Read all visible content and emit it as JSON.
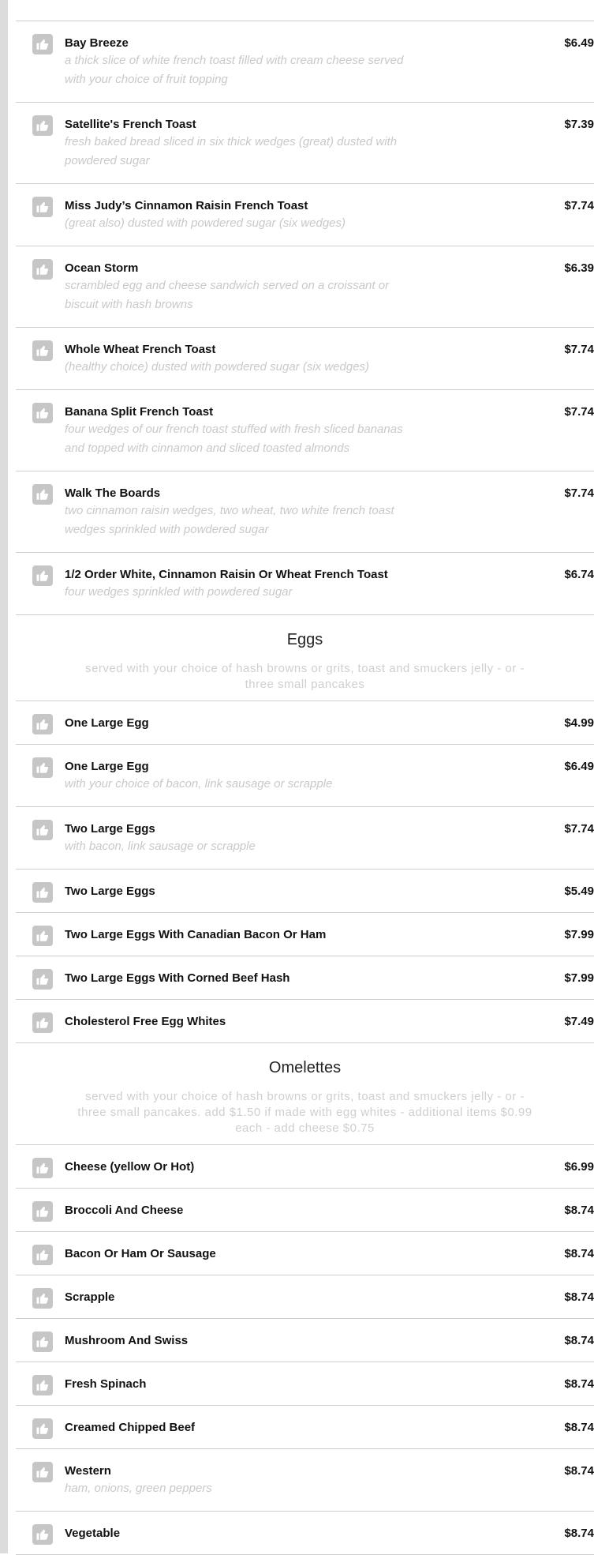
{
  "groups": [
    {
      "items": [
        {
          "name": "Bay Breeze",
          "desc": "a thick slice of white french toast filled with cream cheese served with your choice of fruit topping",
          "price": "$6.49"
        },
        {
          "name": "Satellite's French Toast",
          "desc": "fresh baked bread sliced in six thick wedges (great) dusted with powdered sugar",
          "price": "$7.39"
        },
        {
          "name": "Miss Judy’s Cinnamon Raisin French Toast",
          "desc": "(great also) dusted with powdered sugar (six wedges)",
          "price": "$7.74"
        },
        {
          "name": "Ocean Storm",
          "desc": "scrambled egg and cheese sandwich served on a croissant or biscuit with hash browns",
          "price": "$6.39"
        },
        {
          "name": "Whole Wheat French Toast",
          "desc": "(healthy choice) dusted with powdered sugar (six wedges)",
          "price": "$7.74"
        },
        {
          "name": "Banana Split French Toast",
          "desc": "four wedges of our french toast stuffed with fresh sliced bananas and topped with cinnamon and sliced toasted almonds",
          "price": "$7.74"
        },
        {
          "name": "Walk The Boards",
          "desc": "two cinnamon raisin wedges, two wheat, two white french toast wedges sprinkled with powdered sugar",
          "price": "$7.74"
        },
        {
          "name": "1/2 Order White, Cinnamon Raisin Or Wheat French Toast",
          "desc": "four wedges sprinkled with powdered sugar",
          "price": "$6.74"
        }
      ]
    },
    {
      "title": "Eggs",
      "note": "served with your choice of hash browns or grits, toast and smuckers jelly - or - three small pancakes",
      "items": [
        {
          "name": "One Large Egg",
          "desc": "",
          "price": "$4.99"
        },
        {
          "name": "One Large Egg",
          "desc": "with your choice of bacon, link sausage or scrapple",
          "price": "$6.49"
        },
        {
          "name": "Two Large Eggs",
          "desc": "with bacon, link sausage or scrapple",
          "price": "$7.74"
        },
        {
          "name": "Two Large Eggs",
          "desc": "",
          "price": "$5.49"
        },
        {
          "name": "Two Large Eggs With Canadian Bacon Or Ham",
          "desc": "",
          "price": "$7.99"
        },
        {
          "name": "Two Large Eggs With Corned Beef Hash",
          "desc": "",
          "price": "$7.99"
        },
        {
          "name": "Cholesterol Free Egg Whites",
          "desc": "",
          "price": "$7.49"
        }
      ]
    },
    {
      "title": "Omelettes",
      "note": "served with your choice of hash browns or grits, toast and smuckers jelly - or - three small pancakes. add $1.50 if made with egg whites - additional items $0.99 each - add cheese $0.75",
      "items": [
        {
          "name": "Cheese (yellow Or Hot)",
          "desc": "",
          "price": "$6.99"
        },
        {
          "name": "Broccoli And Cheese",
          "desc": "",
          "price": "$8.74"
        },
        {
          "name": "Bacon Or Ham Or Sausage",
          "desc": "",
          "price": "$8.74"
        },
        {
          "name": "Scrapple",
          "desc": "",
          "price": "$8.74"
        },
        {
          "name": "Mushroom And Swiss",
          "desc": "",
          "price": "$8.74"
        },
        {
          "name": "Fresh Spinach",
          "desc": "",
          "price": "$8.74"
        },
        {
          "name": "Creamed Chipped Beef",
          "desc": "",
          "price": "$8.74"
        },
        {
          "name": "Western",
          "desc": "ham, onions, green peppers",
          "price": "$8.74"
        },
        {
          "name": "Vegetable",
          "desc": "",
          "price": "$8.74"
        }
      ]
    }
  ],
  "icons": {
    "like": "thumbs-up-icon"
  },
  "colors": {
    "icon_bg": "#c6c6c6",
    "desc_text": "#c9c9c9",
    "divider": "#cfcfcf",
    "left_bar": "#dcdcdc"
  }
}
